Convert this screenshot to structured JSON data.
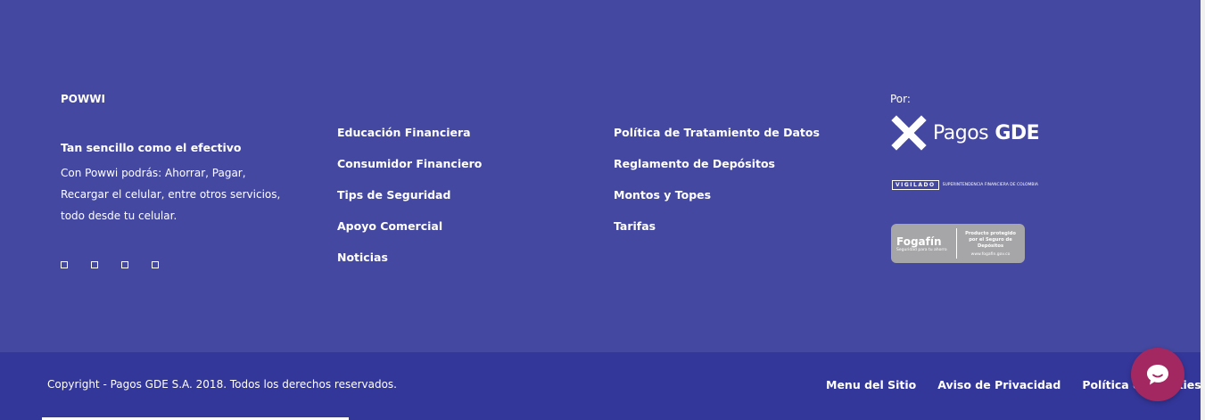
{
  "brand": {
    "name": "POWWI"
  },
  "about": {
    "tagline": "Tan sencillo como el efectivo",
    "lines": [
      "Con Powwi podrás: Ahorrar, Pagar,",
      "Recargar el celular, entre otros servicios,",
      "todo desde tu celular."
    ]
  },
  "social_icons": [
    "facebook-icon",
    "twitter-icon",
    "instagram-icon",
    "youtube-icon"
  ],
  "links_col1": [
    "Educación Financiera",
    "Consumidor Financiero",
    "Tips de Seguridad",
    "Apoyo Comercial",
    "Noticias"
  ],
  "links_col2": [
    "Política de Tratamiento de Datos",
    "Reglamento de Depósitos",
    "Montos y Topes",
    "Tarifas"
  ],
  "partner": {
    "label": "Por:",
    "logo_text_1": "Pagos",
    "logo_text_2": "GDE",
    "vigilado": "VIGILADO",
    "superintendencia": "SUPERINTENDENCIA FINANCIERA DE COLOMBIA",
    "fogafin_name": "Fogafín",
    "fogafin_slogan": "Seguridad para tu ahorro",
    "fogafin_protected": "Producto protegido por el Seguro de Depósitos",
    "fogafin_url": "www.fogafin.gov.co"
  },
  "bottom": {
    "copyright": "Copyright - Pagos GDE S.A. 2018. Todos los derechos reservados.",
    "links": [
      "Menu del Sitio",
      "Aviso de Privacidad",
      "Política de Cookies"
    ]
  },
  "colors": {
    "footer_bg": "#4448a0",
    "bottom_bg": "#34379a",
    "chat_button": "#a32862"
  },
  "chat": {
    "icon": "chat-bubble-icon"
  }
}
